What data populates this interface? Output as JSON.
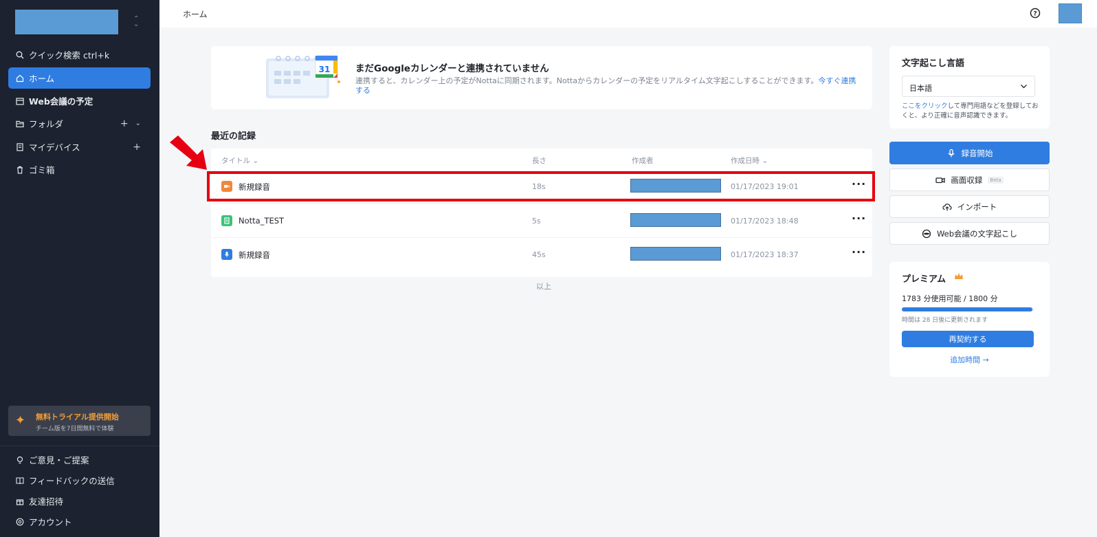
{
  "sidebar": {
    "quick_search": "クイック検索 ctrl+k",
    "items": [
      {
        "label": "ホーム"
      },
      {
        "label": "Web会議の予定"
      },
      {
        "label": "フォルダ"
      },
      {
        "label": "マイデバイス"
      },
      {
        "label": "ゴミ箱"
      }
    ],
    "trial": {
      "title": "無料トライアル提供開始",
      "subtitle": "チーム版を7日間無料で体験"
    },
    "bottom_items": [
      {
        "label": "ご意見・ご提案"
      },
      {
        "label": "フィードバックの送信"
      },
      {
        "label": "友達招待"
      },
      {
        "label": "アカウント"
      }
    ]
  },
  "topbar": {
    "breadcrumb": "ホーム"
  },
  "banner": {
    "title": "まだGoogleカレンダーと連携されていません",
    "text": "連携すると、カレンダー上の予定がNottaに同期されます。Nottaからカレンダーの予定をリアルタイム文字起こしすることができます。",
    "link": "今すぐ連携する",
    "calendar_day": "31"
  },
  "recent": {
    "title": "最近の記録",
    "columns": {
      "title": "タイトル",
      "length": "長さ",
      "author": "作成者",
      "created": "作成日時"
    },
    "rows": [
      {
        "title": "新規録音",
        "length": "18s",
        "date": "01/17/2023 19:01",
        "icon": "video-icon",
        "icon_color": "#f0883a"
      },
      {
        "title": "Notta_TEST",
        "length": "5s",
        "date": "01/17/2023 18:48",
        "icon": "import-file-icon",
        "icon_color": "#3cc27a"
      },
      {
        "title": "新規録音",
        "length": "45s",
        "date": "01/17/2023 18:37",
        "icon": "mic-icon",
        "icon_color": "#2f7de1"
      }
    ],
    "end_label": "以上"
  },
  "language": {
    "title": "文字起こし言語",
    "selected": "日本語",
    "help_link": "ここをクリック",
    "help_text": "して専門用語などを登録しておくと、より正確に音声認識できます。"
  },
  "actions": {
    "record": "録音開始",
    "screen_record": "画面収録",
    "beta": "Beta",
    "import": "インポート",
    "web_meeting": "Web会議の文字起こし"
  },
  "premium": {
    "title": "プレミアム",
    "usage": "1783 分使用可能 / 1800 分",
    "usage_fraction": 0.99,
    "renew": "時間は 28 日後に更新されます",
    "renew_button": "再契約する",
    "add_time": "追加時間 →"
  },
  "colors": {
    "accent": "#2f7de1",
    "sidebar_bg": "#1c2230",
    "highlight": "#e60012",
    "redacted": "#5b9bd5"
  }
}
